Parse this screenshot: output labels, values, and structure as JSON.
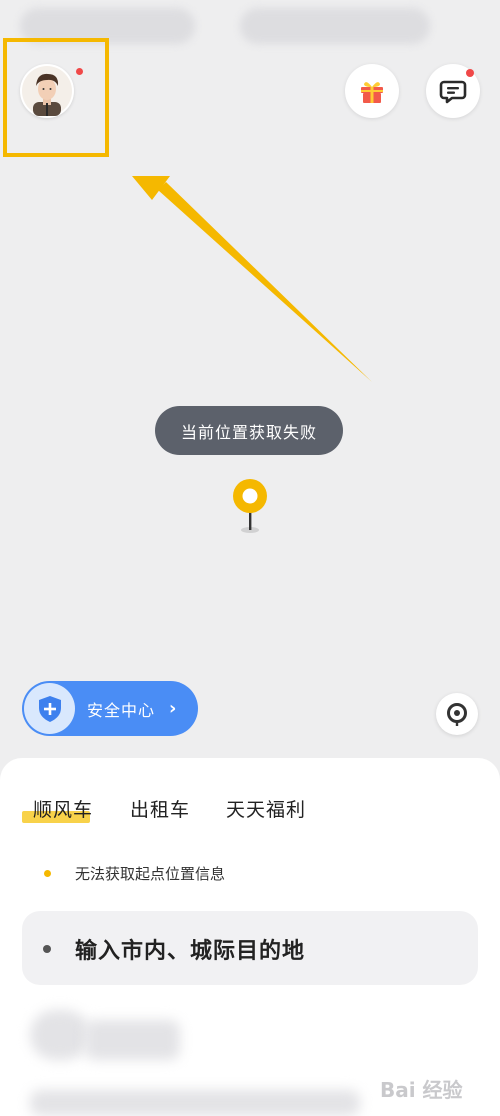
{
  "colors": {
    "accent_yellow": "#f5b800",
    "toast_bg": "#5c616b",
    "safety_blue": "#4a8df5",
    "badge_red": "#f04848"
  },
  "header": {
    "avatar_icon": "user-avatar",
    "gift_icon": "gift-icon",
    "message_icon": "message-icon"
  },
  "toast": {
    "text": "当前位置获取失败"
  },
  "safety": {
    "label": "安全中心",
    "icon": "shield-plus-icon",
    "chevron": "›"
  },
  "bottom_sheet": {
    "tabs": [
      {
        "label": "顺风车",
        "active": true
      },
      {
        "label": "出租车",
        "active": false
      },
      {
        "label": "天天福利",
        "active": false
      }
    ],
    "start_warning": "无法获取起点位置信息",
    "destination_placeholder": "输入市内、城际目的地"
  },
  "watermark": {
    "text": "Bai 经验"
  }
}
